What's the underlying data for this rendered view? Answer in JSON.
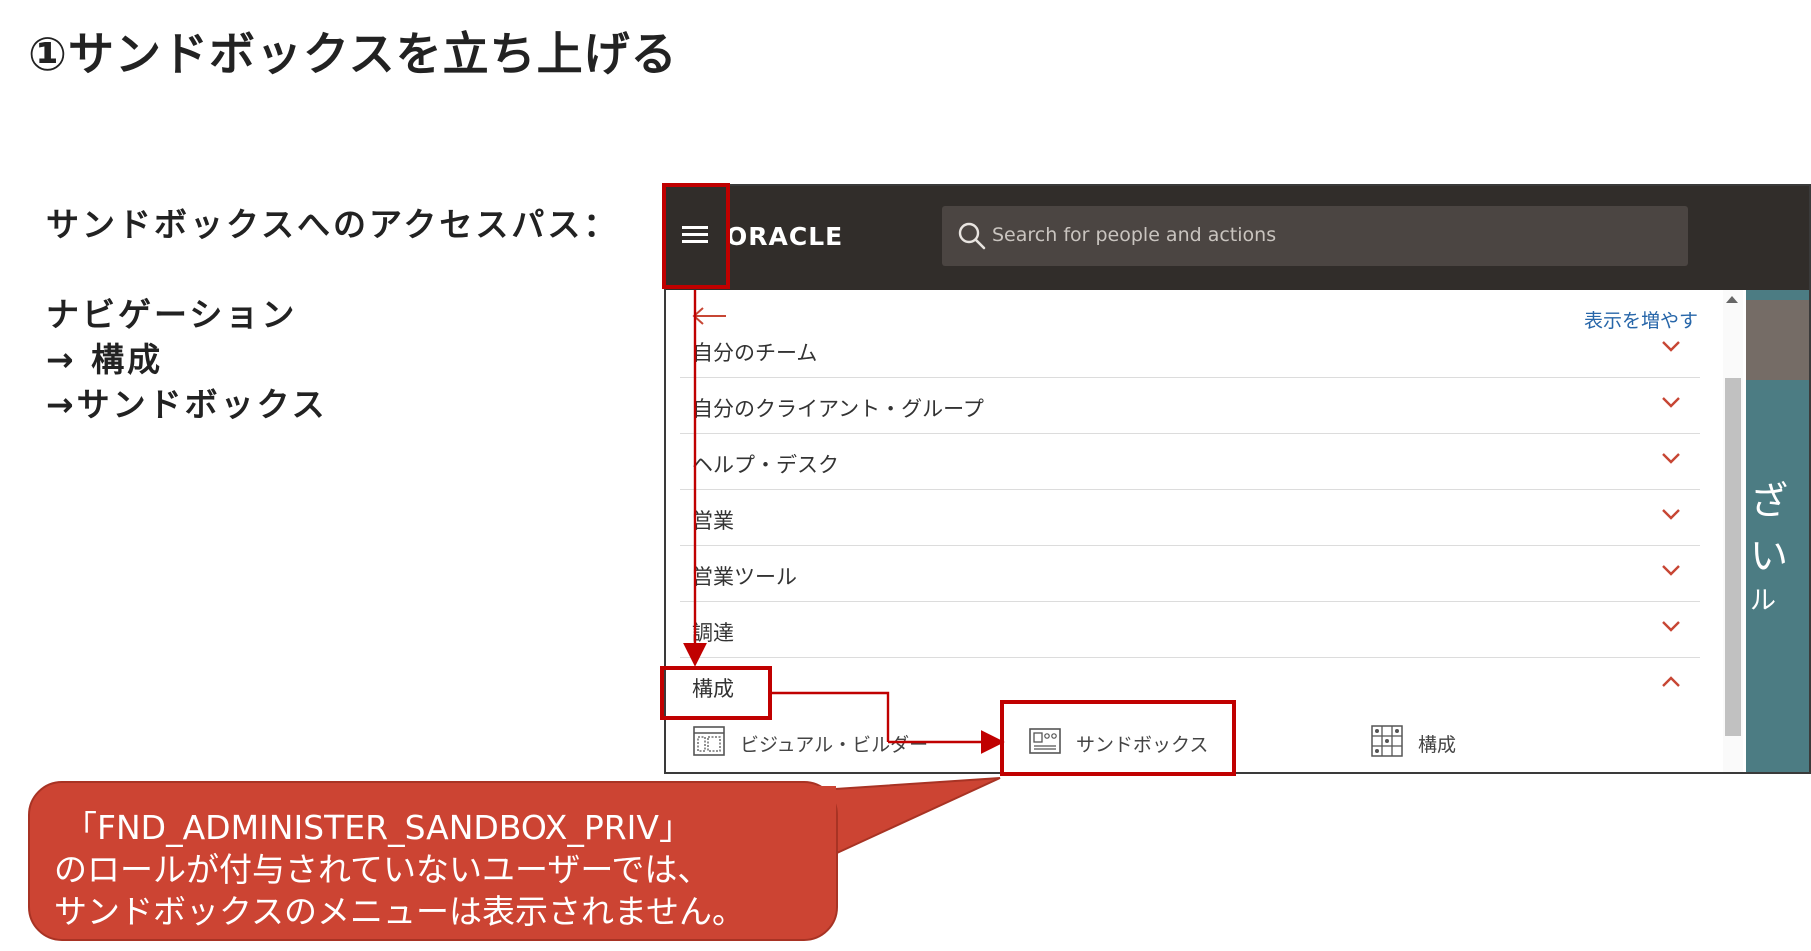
{
  "slide": {
    "title": "①サンドボックスを立ち上げる",
    "access_label": "サンドボックスへのアクセスパス：",
    "nav_path": [
      "ナビゲーション",
      "→ 構成",
      "→サンドボックス"
    ]
  },
  "app": {
    "logo": "ORACLE",
    "search_placeholder": "Search for people and actions",
    "show_more": "表示を増やす",
    "menu_items": [
      {
        "label": "自分のチーム"
      },
      {
        "label": "自分のクライアント・グループ"
      },
      {
        "label": "ヘルプ・デスク"
      },
      {
        "label": "営業"
      },
      {
        "label": "営業ツール"
      },
      {
        "label": "調達"
      },
      {
        "label": "構成"
      }
    ],
    "sub_items": [
      {
        "label": "ビジュアル・ビルダー",
        "icon": "visual-builder-icon"
      },
      {
        "label": "サンドボックス",
        "icon": "sandbox-icon"
      },
      {
        "label": "構成",
        "icon": "structure-icon"
      }
    ],
    "background_text": [
      "ざい",
      "ル"
    ]
  },
  "callout": {
    "lines": [
      "「FND_ADMINISTER_SANDBOX_PRIV」",
      "のロールが付与されていないユーザーでは、",
      "サンドボックスのメニューは表示されません。"
    ]
  },
  "colors": {
    "highlight": "#c00000",
    "callout": "#cc4433",
    "topbar": "#312d2a",
    "accent_link": "#2766a9",
    "chevron": "#c74634"
  }
}
